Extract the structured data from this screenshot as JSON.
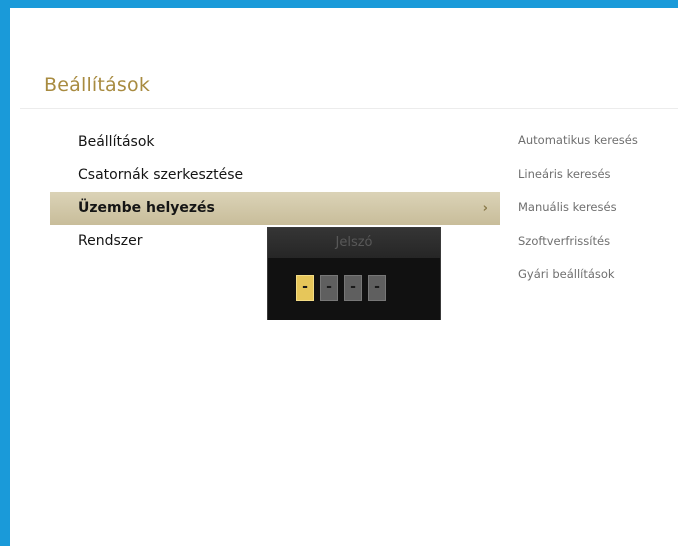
{
  "header": {
    "title": "Beállítások"
  },
  "menu": {
    "items": [
      {
        "label": "Beállítások"
      },
      {
        "label": "Csatornák szerkesztése"
      },
      {
        "label": "Üzembe helyezés",
        "chevron": "›"
      },
      {
        "label": "Rendszer"
      }
    ],
    "selected_index": 2
  },
  "submenu": {
    "items": [
      {
        "label": "Automatikus keresés"
      },
      {
        "label": "Lineáris keresés"
      },
      {
        "label": "Manuális keresés"
      },
      {
        "label": "Szoftverfrissítés"
      },
      {
        "label": "Gyári beállítások"
      }
    ]
  },
  "password_dialog": {
    "title": "Jelszó",
    "digits": [
      "-",
      "-",
      "-",
      "-"
    ],
    "active_index": 0
  },
  "colors": {
    "frame": "#1a9ad9",
    "title": "#a88b40",
    "selected_row": "#c8bd9a",
    "active_digit": "#e6c65a"
  }
}
